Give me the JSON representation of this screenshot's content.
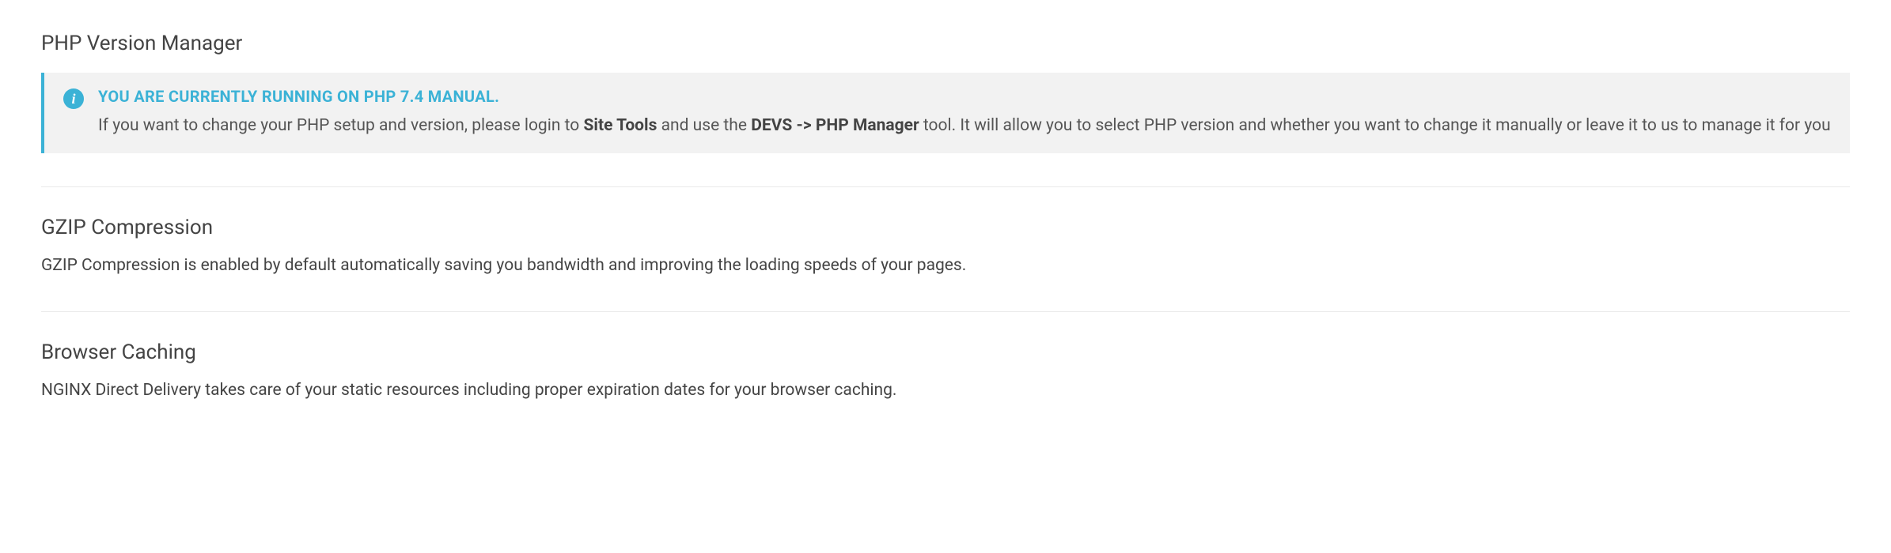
{
  "sections": {
    "php": {
      "title": "PHP Version Manager",
      "info_headline": "YOU ARE CURRENTLY RUNNING ON PHP 7.4 MANUAL.",
      "info_body_pre": "If you want to change your PHP setup and version, please login to ",
      "info_body_bold1": "Site Tools",
      "info_body_mid": " and use the ",
      "info_body_bold2": "DEVS -> PHP Manager",
      "info_body_post": " tool. It will allow you to select PHP version and whether you want to change it manually or leave it to us to manage it for you"
    },
    "gzip": {
      "title": "GZIP Compression",
      "desc": "GZIP Compression is enabled by default automatically saving you bandwidth and improving the loading speeds of your pages."
    },
    "cache": {
      "title": "Browser Caching",
      "desc": "NGINX Direct Delivery takes care of your static resources including proper expiration dates for your browser caching."
    }
  }
}
